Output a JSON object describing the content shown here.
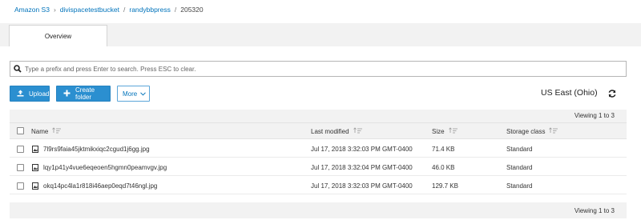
{
  "breadcrumb": {
    "items": [
      "Amazon S3",
      "divispacetestbucket",
      "randybbpress"
    ],
    "current": "205320",
    "separator": "/",
    "first_separator": "›"
  },
  "tabs": [
    {
      "label": "Overview"
    }
  ],
  "search": {
    "placeholder": "Type a prefix and press Enter to search. Press ESC to clear.",
    "value": ""
  },
  "toolbar": {
    "upload_label": "Upload",
    "create_folder_label": "Create folder",
    "more_label": "More"
  },
  "region": "US East (Ohio)",
  "table": {
    "viewing_top": "Viewing 1 to 3",
    "viewing_bottom": "Viewing 1 to 3",
    "columns": [
      "Name",
      "Last modified",
      "Size",
      "Storage class"
    ],
    "rows": [
      {
        "name": "7l9rs9faia45jktmikxiqc2cgud1j6gg.jpg",
        "modified": "Jul 17, 2018 3:32:03 PM GMT-0400",
        "size": "71.4 KB",
        "storage": "Standard"
      },
      {
        "name": "lqy1p41y4vue6eqeoen5hgmn0peamvgv.jpg",
        "modified": "Jul 17, 2018 3:32:04 PM GMT-0400",
        "size": "46.0 KB",
        "storage": "Standard"
      },
      {
        "name": "okq14pc4la1r818i46aep0eqd7t46ngl.jpg",
        "modified": "Jul 17, 2018 3:32:03 PM GMT-0400",
        "size": "129.7 KB",
        "storage": "Standard"
      }
    ]
  },
  "colors": {
    "accent": "#2b8fd0",
    "link": "#0073bb",
    "header_bg": "#f2f2f2"
  },
  "icons": [
    "search-icon",
    "upload-icon",
    "plus-icon",
    "chevron-down-icon",
    "refresh-icon",
    "sort-icon",
    "image-file-icon"
  ]
}
